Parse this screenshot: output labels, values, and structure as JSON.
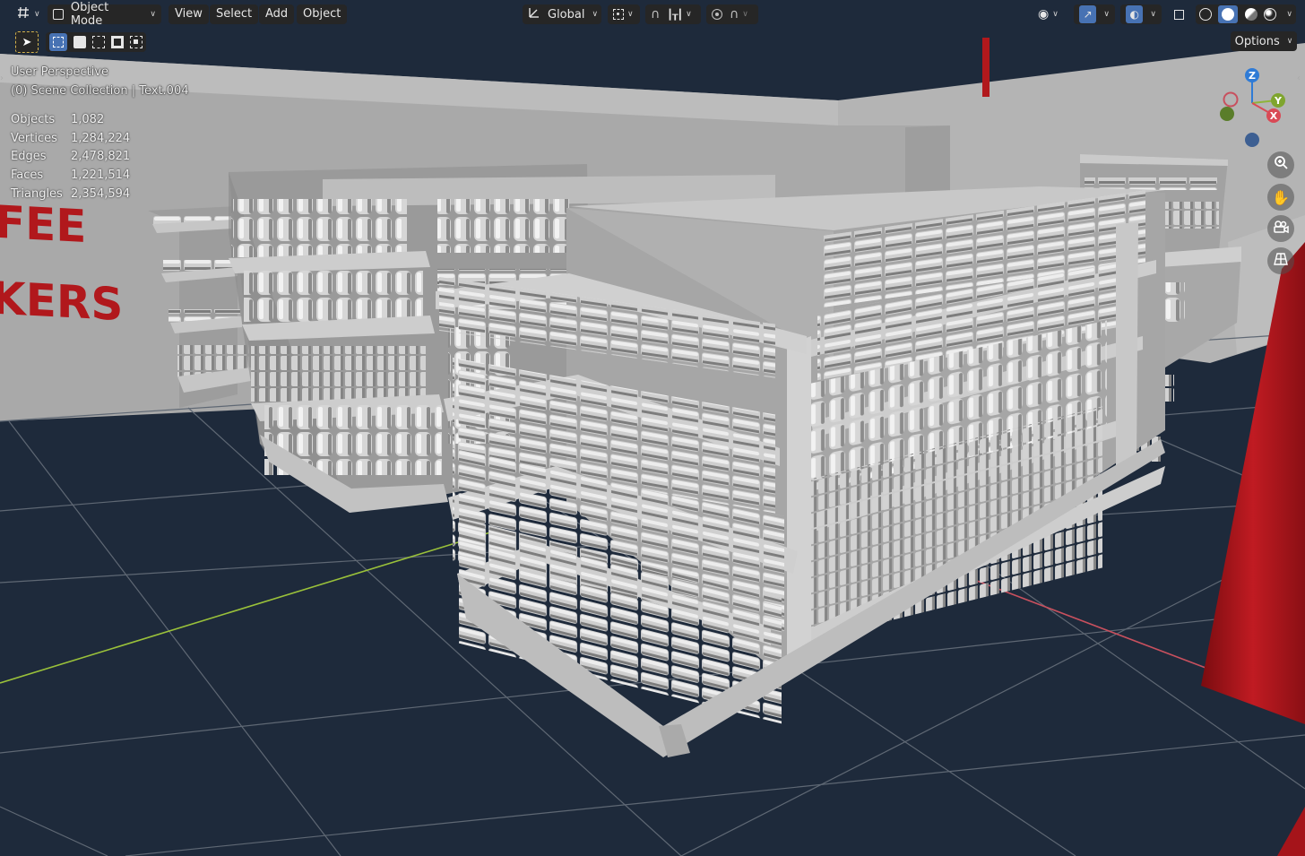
{
  "header": {
    "mode": "Object Mode",
    "menus": [
      "View",
      "Select",
      "Add",
      "Object"
    ],
    "transform_orientation": "Global",
    "options_label": "Options"
  },
  "overlay": {
    "view_name": "User Perspective",
    "collection": "(0) Scene Collection | Text.004"
  },
  "stats": [
    {
      "label": "Objects",
      "value": "1,082"
    },
    {
      "label": "Vertices",
      "value": "1,284,224"
    },
    {
      "label": "Edges",
      "value": "2,478,821"
    },
    {
      "label": "Faces",
      "value": "1,221,514"
    },
    {
      "label": "Triangles",
      "value": "2,354,594"
    }
  ],
  "scene_text": {
    "sign_left_top": "FEE",
    "sign_left_bottom": "KERS"
  },
  "gizmo": {
    "z": "Z",
    "y": "Y",
    "x": "X"
  },
  "colors": {
    "viewport_bg": "#1e2a3b",
    "grid": "#5f6874",
    "axis_x": "#c8505e",
    "axis_y": "#9ac13a",
    "shelf": "#a8a8a8",
    "sign_red": "#b1181c",
    "active_blue": "#4772b3"
  },
  "icons": [
    "editor-type-icon",
    "object-mode-icon",
    "transform-orientation-icon",
    "pivot-icon",
    "snap-icon",
    "snap-increment-icon",
    "proportional-icon",
    "falloff-icon",
    "visibility-icon",
    "gizmo-icon",
    "overlay-icon",
    "xray-icon",
    "wireframe-shading-icon",
    "solid-shading-icon",
    "material-shading-icon",
    "rendered-shading-icon",
    "zoom-icon",
    "pan-icon",
    "camera-icon",
    "grid-view-icon"
  ]
}
